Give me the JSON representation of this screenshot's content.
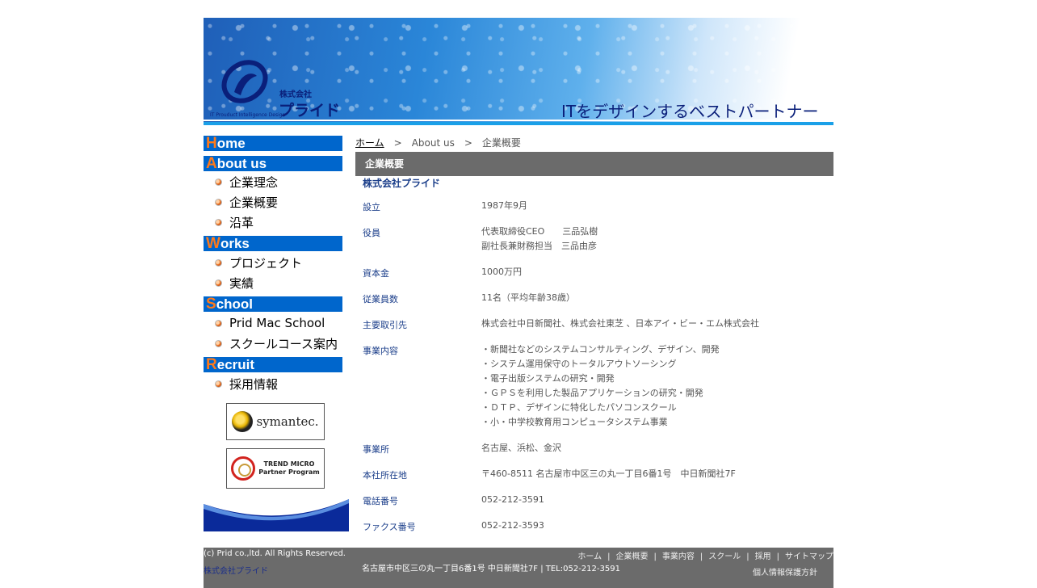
{
  "header": {
    "logo_small": "株式会社",
    "logo_big": "プライド",
    "logo_tag": "IT Prouduct Intelligence Design",
    "tagline": "ITをデザインするベストパートナー"
  },
  "sidebar": {
    "sections": [
      {
        "cap": "H",
        "rest": "ome",
        "items": []
      },
      {
        "cap": "A",
        "rest": "bout us",
        "items": [
          "企業理念",
          "企業概要",
          "沿革"
        ]
      },
      {
        "cap": "W",
        "rest": "orks",
        "items": [
          "プロジェクト",
          "実績"
        ]
      },
      {
        "cap": "S",
        "rest": "chool",
        "items": [
          "Prid Mac School",
          "スクールコース案内"
        ]
      },
      {
        "cap": "R",
        "rest": "ecruit",
        "items": [
          "採用情報"
        ]
      }
    ],
    "badges": {
      "symantec": "symantec.",
      "trend_line1": "TREND MICRO",
      "trend_line2": "Partner Program"
    }
  },
  "breadcrumb": {
    "home": "ホーム",
    "sep": ">",
    "about": "About us",
    "current": "企業概要"
  },
  "main": {
    "title": "企業概要",
    "company": "株式会社プライド",
    "rows": [
      {
        "k": "設立",
        "v": [
          "1987年9月"
        ]
      },
      {
        "k": "役員",
        "v": [
          "代表取締役CEO　　三品弘樹",
          "副社長兼財務担当　三品由彦"
        ]
      },
      {
        "k": "資本金",
        "v": [
          "1000万円"
        ]
      },
      {
        "k": "従業員数",
        "v": [
          "11名（平均年齢38歳）"
        ]
      },
      {
        "k": "主要取引先",
        "v": [
          "株式会社中日新聞社、株式会社東芝 、日本アイ・ビー・エム株式会社"
        ]
      },
      {
        "k": "事業内容",
        "v": [
          "・新聞社などのシステムコンサルティング、デザイン、開発",
          "・システム運用保守のトータルアウトソーシング",
          "・電子出版システムの研究・開発",
          "・ＧＰＳを利用した製品アプリケーションの研究・開発",
          "・ＤＴＰ、デザインに特化したパソコンスクール",
          "・小・中学校教育用コンピュータシステム事業"
        ]
      },
      {
        "k": "事業所",
        "v": [
          "名古屋、浜松、金沢"
        ]
      },
      {
        "k": "本社所在地",
        "v": [
          "〒460-8511 名古屋市中区三の丸一丁目6番1号　中日新聞社7F"
        ]
      },
      {
        "k": "電話番号",
        "v": [
          "052-212-3591"
        ]
      },
      {
        "k": "ファクス番号",
        "v": [
          "052-212-3593"
        ]
      }
    ]
  },
  "footer": {
    "copyright": "(c) Prid co.,ltd. All Rights Reserved.",
    "company": "株式会社プライド",
    "address": "名古屋市中区三の丸一丁目6番1号 中日新聞社7F | TEL:052-212-3591",
    "links": [
      "ホーム",
      "企業概要",
      "事業内容",
      "スクール",
      "採用",
      "サイトマップ"
    ],
    "privacy": "個人情報保護方針"
  }
}
